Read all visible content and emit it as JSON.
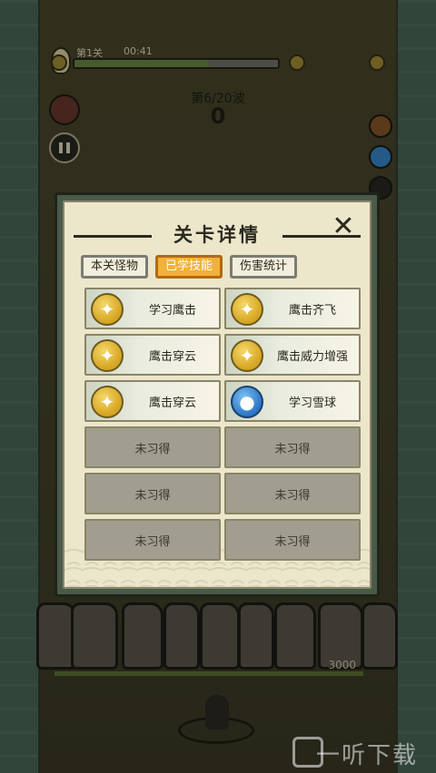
{
  "hud": {
    "stage": "第1关",
    "timer": "00:41",
    "progress": 0.66,
    "wave": "第6/20波",
    "score": "0",
    "boss_hp": "3000"
  },
  "dialog": {
    "title": "关卡详情",
    "close_icon": "close-x-icon",
    "tabs": [
      {
        "label": "本关怪物",
        "active": false
      },
      {
        "label": "已学技能",
        "active": true
      },
      {
        "label": "伤害统计",
        "active": false
      }
    ],
    "skills": [
      {
        "name": "学习鹰击",
        "icon": "eagle-icon",
        "learned": true
      },
      {
        "name": "鹰击齐飞",
        "icon": "eagle-icon",
        "learned": true
      },
      {
        "name": "鹰击穿云",
        "icon": "eagle-icon",
        "learned": true
      },
      {
        "name": "鹰击威力增强",
        "icon": "eagle-icon",
        "learned": true
      },
      {
        "name": "鹰击穿云",
        "icon": "eagle-icon",
        "learned": true
      },
      {
        "name": "学习雪球",
        "icon": "snowball-icon",
        "learned": true
      },
      {
        "name": "未习得",
        "learned": false
      },
      {
        "name": "未习得",
        "learned": false
      },
      {
        "name": "未习得",
        "learned": false
      },
      {
        "name": "未习得",
        "learned": false
      },
      {
        "name": "未习得",
        "learned": false
      },
      {
        "name": "未习得",
        "learned": false
      }
    ]
  },
  "watermark": "一听下载",
  "colors": {
    "panel_bg": "#ece6cb",
    "tab_active": "#f2b13a",
    "locked_cell": "#a19e8f",
    "eagle_gold": "#d5a320",
    "snow_blue": "#2b74c8"
  }
}
